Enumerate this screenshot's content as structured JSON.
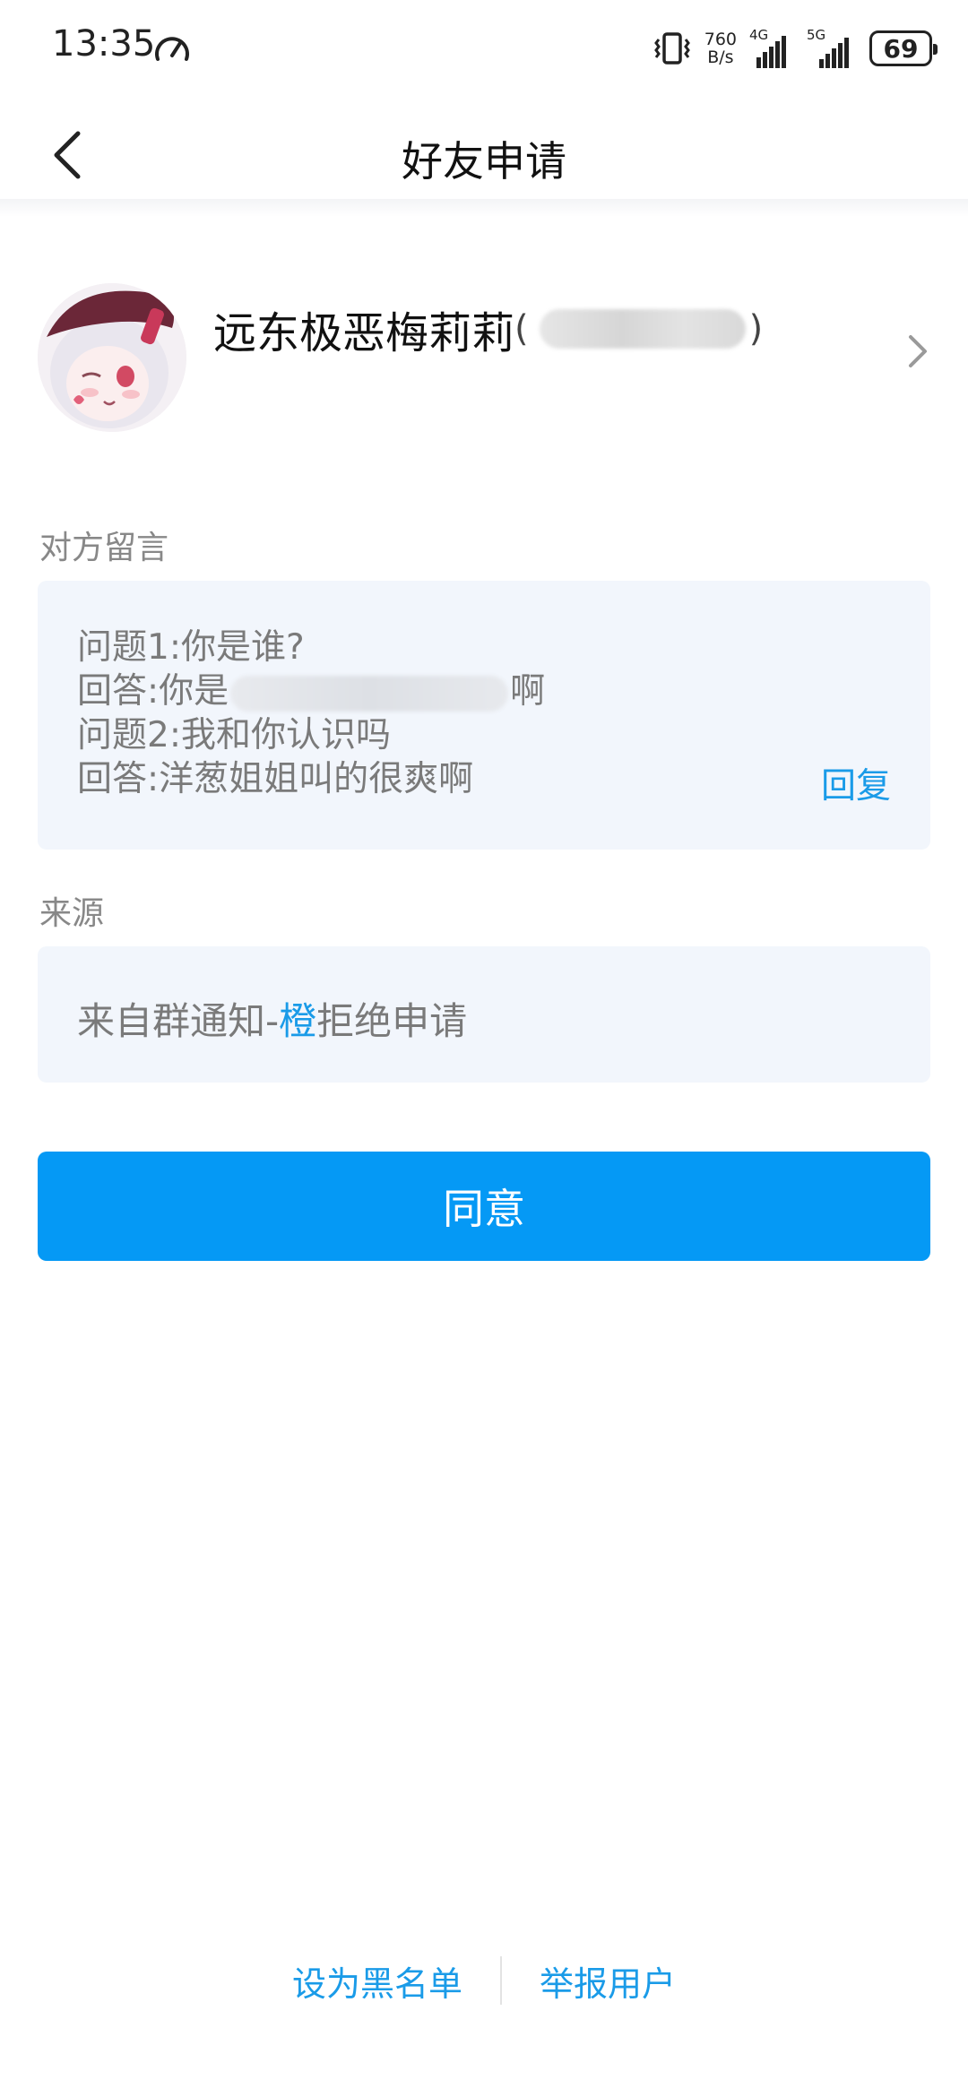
{
  "status_bar": {
    "time": "13:35",
    "net_speed_value": "760",
    "net_speed_unit": "B/s",
    "sim1_label": "4G",
    "sim2_label": "5G",
    "battery": "69"
  },
  "header": {
    "title": "好友申请"
  },
  "profile": {
    "nickname": "远东极恶梅莉莉",
    "paren_open": "(",
    "paren_close": ")"
  },
  "message": {
    "label": "对方留言",
    "lines": [
      "问题1:你是谁?",
      "回答:你是",
      "啊",
      "问题2:我和你认识吗",
      "回答:洋葱姐姐叫的很爽啊"
    ],
    "reply_label": "回复"
  },
  "source": {
    "label": "来源",
    "prefix": "来自群通知-",
    "highlight": "橙",
    "suffix": "拒绝申请"
  },
  "actions": {
    "agree_label": "同意",
    "blacklist_label": "设为黑名单",
    "report_label": "举报用户"
  },
  "colors": {
    "accent": "#0599f5",
    "link": "#1a9be8",
    "card_bg": "#f2f6fc",
    "label_gray": "#888888"
  }
}
